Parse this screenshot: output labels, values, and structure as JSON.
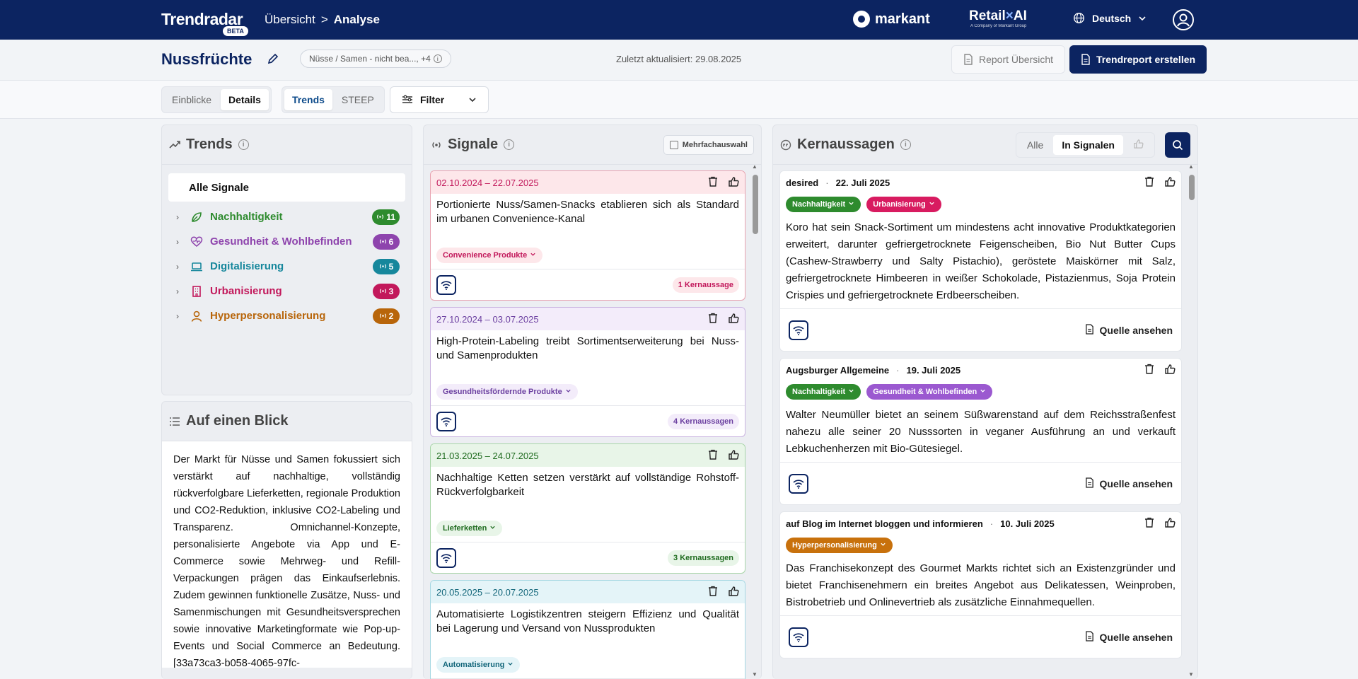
{
  "nav": {
    "brand": "Trendradar",
    "beta": "BETA",
    "crumb_home": "Übersicht",
    "crumb_sep": ">",
    "crumb_current": "Analyse",
    "markant": "markant",
    "retail_a": "Retail",
    "retail_x": "×",
    "retail_b": "AI",
    "retail_sub": "A Company of Markant Group",
    "language": "Deutsch"
  },
  "titlebar": {
    "title": "Nussfrüchte",
    "category_chip": "Nüsse / Samen - nicht bea..., +4",
    "updated": "Zuletzt aktualisiert: 29.08.2025",
    "report_button": "Report Übersicht",
    "create_button": "Trendreport erstellen"
  },
  "toolbar": {
    "view_tabs": [
      "Einblicke",
      "Details"
    ],
    "active_view": "Details",
    "mode_tabs": [
      "Trends",
      "STEEP"
    ],
    "active_mode": "Trends",
    "filter_label": "Filter"
  },
  "trends": {
    "title": "Trends",
    "all_label": "Alle Signale",
    "items": [
      {
        "label": "Nachhaltigkeit",
        "count": "11",
        "color": "#2e8b2e",
        "icon": "leaf-icon"
      },
      {
        "label": "Gesundheit & Wohlbefinden",
        "count": "6",
        "color": "#8e44ad",
        "icon": "heart-pulse-icon"
      },
      {
        "label": "Digitalisierung",
        "count": "5",
        "color": "#16879c",
        "icon": "laptop-icon"
      },
      {
        "label": "Urbanisierung",
        "count": "3",
        "color": "#c2185b",
        "icon": "building-icon"
      },
      {
        "label": "Hyperpersonalisierung",
        "count": "2",
        "color": "#b8650a",
        "icon": "person-icon"
      }
    ]
  },
  "blick": {
    "title": "Auf einen Blick",
    "text": "Der Markt für Nüsse und Samen fokussiert sich verstärkt auf nachhaltige, vollständig rückverfolgbare Lieferketten, regionale Produktion und CO2-Reduktion, inklusive CO2-Labeling und Transparenz. Omnichannel-Konzepte, personalisierte Angebote via App und E-Commerce sowie Mehrweg- und Refill-Verpackungen prägen das Einkaufserlebnis. Zudem gewinnen funktionelle Zusätze, Nuss- und Samenmischungen mit Gesundheitsversprechen sowie innovative Marketingformate wie Pop-up-Events und Social Commerce an Bedeutung. [33a73ca3-b058-4065-97fc-"
  },
  "signale": {
    "title": "Signale",
    "multi_select": "Mehrfachauswahl",
    "cards": [
      {
        "date": "02.10.2024 – 22.07.2025",
        "text": "Portionierte Nuss/Samen-Snacks etablieren sich als Standard im urbanen Convenience-Kanal",
        "tag": "Convenience Produkte",
        "kern": "1 Kernaussage",
        "accent": "#e8a2b0",
        "head_bg": "#fde7ea",
        "date_color": "#c2185b",
        "tag_bg": "#fde7ea",
        "tag_color": "#c2185b"
      },
      {
        "date": "27.10.2024 – 03.07.2025",
        "text": "High-Protein-Labeling treibt Sortimentserweiterung bei Nuss- und Samenprodukten",
        "tag": "Gesundheitsfördernde Produkte",
        "kern": "4 Kernaussagen",
        "accent": "#c9b3e0",
        "head_bg": "#f3ecfa",
        "date_color": "#6b3fa0",
        "tag_bg": "#f3ecfa",
        "tag_color": "#6b3fa0"
      },
      {
        "date": "21.03.2025 – 24.07.2025",
        "text": "Nachhaltige Ketten setzen verstärkt auf vollständige Rohstoff-Rückverfolgbarkeit",
        "tag": "Lieferketten",
        "kern": "3 Kernaussagen",
        "accent": "#a8d5a8",
        "head_bg": "#e8f5e8",
        "date_color": "#1e6b1e",
        "tag_bg": "#e8f5e8",
        "tag_color": "#1e6b1e"
      },
      {
        "date": "20.05.2025 – 20.07.2025",
        "text": "Automatisierte Logistikzentren steigern Effizienz und Qualität bei Lagerung und Versand von Nussprodukten",
        "tag": "Automatisierung",
        "kern": "",
        "accent": "#a6d8e3",
        "head_bg": "#e4f4f8",
        "date_color": "#12667a",
        "tag_bg": "#e4f4f8",
        "tag_color": "#12667a"
      }
    ]
  },
  "kern": {
    "title": "Kernaussagen",
    "filter_all": "Alle",
    "filter_signals": "In Signalen",
    "source_label": "Quelle ansehen",
    "cards": [
      {
        "source": "desired",
        "date": "22. Juli 2025",
        "tags": [
          {
            "label": "Nachhaltigkeit",
            "color": "#2e8b2e"
          },
          {
            "label": "Urbanisierung",
            "color": "#d81b60"
          }
        ],
        "text": "Koro hat sein Snack-Sortiment um mindestens acht innovative Produktkategorien erweitert, darunter gefriergetrocknete Feigenscheiben, Bio Nut Butter Cups (Cashew-Strawberry und Salty Pistachio), geröstete Maiskörner mit Salz, gefriergetrocknete Himbeeren in weißer Schokolade, Pistazienmus, Soja Protein Crispies und gefriergetrocknete Erdbeerscheiben."
      },
      {
        "source": "Augsburger Allgemeine",
        "date": "19. Juli 2025",
        "tags": [
          {
            "label": "Nachhaltigkeit",
            "color": "#2e8b2e"
          },
          {
            "label": "Gesundheit & Wohlbefinden",
            "color": "#9b59d0"
          }
        ],
        "text": "Walter Neumüller bietet an seinem Süßwarenstand auf dem Reichsstraßenfest nahezu alle seiner 20 Nusssorten in veganer Ausführung an und verkauft Lebkuchenherzen mit Bio-Gütesiegel."
      },
      {
        "source": "auf Blog im Internet bloggen und informieren",
        "date": "10. Juli 2025",
        "tags": [
          {
            "label": "Hyperpersonalisierung",
            "color": "#c8710c"
          }
        ],
        "text": "Das Franchisekonzept des Gourmet Markts richtet sich an Existenzgründer und bietet Franchisenehmern ein breites Angebot aus Delikatessen, Weinproben, Bistrobetrieb und Onlinevertrieb als zusätzliche Einnahmequellen."
      }
    ]
  }
}
